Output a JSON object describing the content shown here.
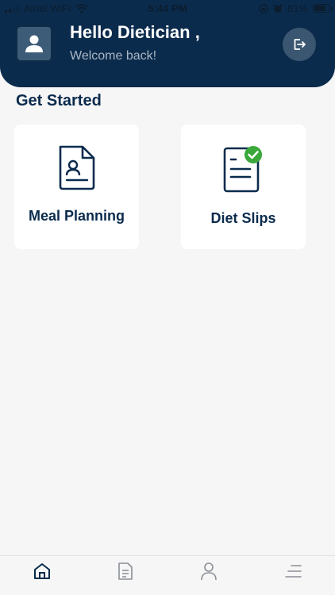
{
  "statusbar": {
    "carrier": "Airtel WiFi",
    "time": "5:44 PM",
    "battery": "81%",
    "battery_level": 0.81
  },
  "header": {
    "greeting": "Hello Dietician ,",
    "subtitle": "Welcome back!"
  },
  "section": {
    "title": "Get Started"
  },
  "cards": [
    {
      "label": "Meal Planning",
      "icon": "profile-document-icon"
    },
    {
      "label": "Diet Slips",
      "icon": "checked-clipboard-icon"
    }
  ],
  "tabs": [
    {
      "icon": "home-icon",
      "active": true
    },
    {
      "icon": "document-icon",
      "active": false
    },
    {
      "icon": "user-icon",
      "active": false
    },
    {
      "icon": "menu-icon",
      "active": false
    }
  ],
  "colors": {
    "primary": "#0b2b4d",
    "accent": "#3aa83a",
    "background": "#f6f6f6"
  }
}
